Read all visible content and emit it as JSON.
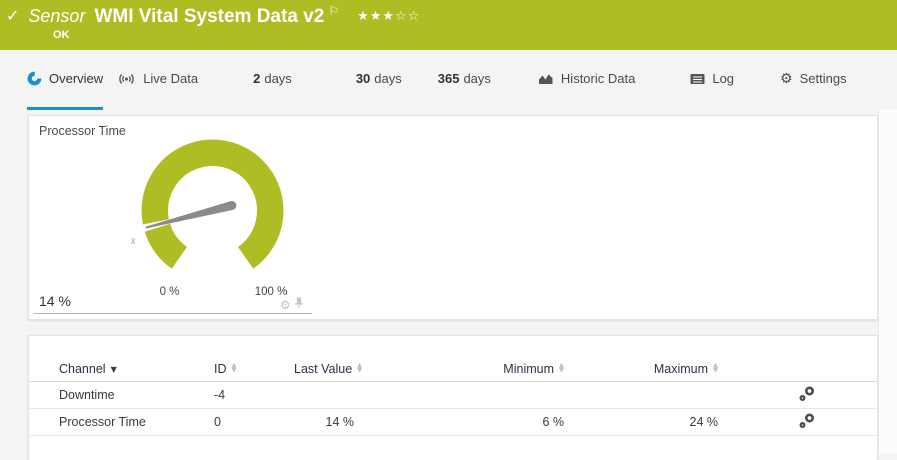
{
  "colors": {
    "ok_green": "#aebd23",
    "accent_blue": "#1892cf",
    "needle_gray": "#8a8a8a",
    "bg_gray": "#f4f4f4"
  },
  "icons": {
    "check": "✓",
    "flag": "⚐",
    "gear": "⚙",
    "sort_desc": "▼",
    "sort_up": "▲",
    "sort_down": "▼"
  },
  "header": {
    "kind_label": "Sensor",
    "title": "WMI Vital System Data v2",
    "status": "OK",
    "rating": {
      "filled": 3,
      "total": 5,
      "display": "★★★☆☆"
    }
  },
  "tabs": [
    {
      "label": "Overview",
      "icon": "gauge-icon",
      "active": true
    },
    {
      "label": "Live Data",
      "icon": "broadcast-icon",
      "active": false
    },
    {
      "number": "2",
      "label": "days",
      "active": false
    },
    {
      "number": "30",
      "label": "days",
      "active": false
    },
    {
      "number": "365",
      "label": "days",
      "active": false
    },
    {
      "label": "Historic Data",
      "icon": "area-chart-icon",
      "active": false
    },
    {
      "label": "Log",
      "icon": "log-icon",
      "active": false
    },
    {
      "label": "Settings",
      "icon": "gear-icon",
      "active": false
    }
  ],
  "gauge_panel": {
    "title": "Processor Time",
    "value_label": "14 %",
    "value_percent": 14,
    "min_label": "0 %",
    "max_label": "100 %",
    "avg_marker": "x̄",
    "gauge_color": "#aebd23"
  },
  "channel_table": {
    "columns": [
      {
        "label": "Channel",
        "sorted": "desc"
      },
      {
        "label": "ID",
        "sorted": "none"
      },
      {
        "label": "Last Value",
        "sorted": "none"
      },
      {
        "label": "Minimum",
        "sorted": "none"
      },
      {
        "label": "Maximum",
        "sorted": "none"
      }
    ],
    "rows": [
      {
        "channel": "Downtime",
        "id": "-4",
        "last_value": "",
        "minimum": "",
        "maximum": ""
      },
      {
        "channel": "Processor Time",
        "id": "0",
        "last_value": "14 %",
        "minimum": "6 %",
        "maximum": "24 %"
      }
    ]
  }
}
